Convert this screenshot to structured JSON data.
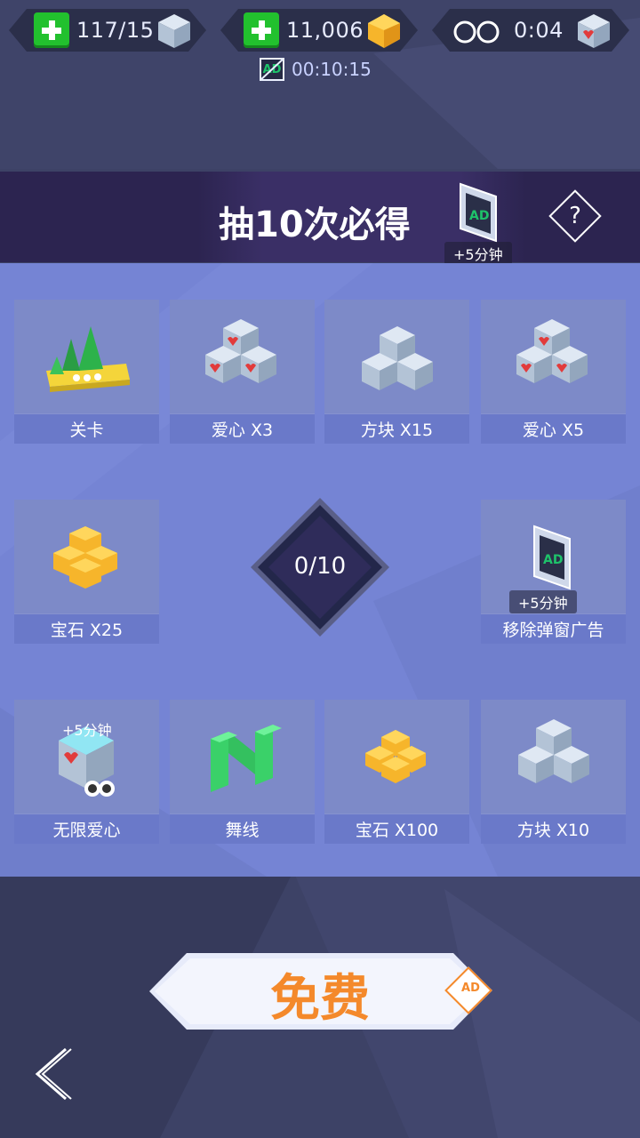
{
  "hud": {
    "cubes_value": "117/15",
    "gems_value": "11,006",
    "infinite_hearts_value": "0:04",
    "ad_timer_value": "00:10:15",
    "ad_icon_text": "AD"
  },
  "banner": {
    "title": "抽10次必得",
    "bonus_label": "+5分钟",
    "help_symbol": "?"
  },
  "grid": {
    "tiles": [
      {
        "label": "关卡",
        "icon": "level-island-icon"
      },
      {
        "label": "爱心 X3",
        "icon": "heart-cubes-icon"
      },
      {
        "label": "方块 X15",
        "icon": "cubes-icon"
      },
      {
        "label": "爱心 X5",
        "icon": "heart-cubes-icon"
      },
      {
        "label": "宝石 X25",
        "icon": "gems-icon"
      },
      {
        "label": "移除弹窗广告",
        "icon": "no-ads-icon",
        "bonus": "+5分钟"
      },
      {
        "label": "无限爱心",
        "icon": "infinite-heart-icon",
        "bonus": "+5分钟"
      },
      {
        "label": "舞线",
        "icon": "dancing-line-icon"
      },
      {
        "label": "宝石 X100",
        "icon": "gems-icon"
      },
      {
        "label": "方块 X10",
        "icon": "cubes-icon"
      }
    ],
    "counter": "0/10"
  },
  "free_button": {
    "label": "免费",
    "ad_badge": "AD"
  },
  "colors": {
    "accent_orange": "#f4892b",
    "plus_green": "#22c12e",
    "panel": "#7584d4",
    "banner": "#2c2450"
  }
}
